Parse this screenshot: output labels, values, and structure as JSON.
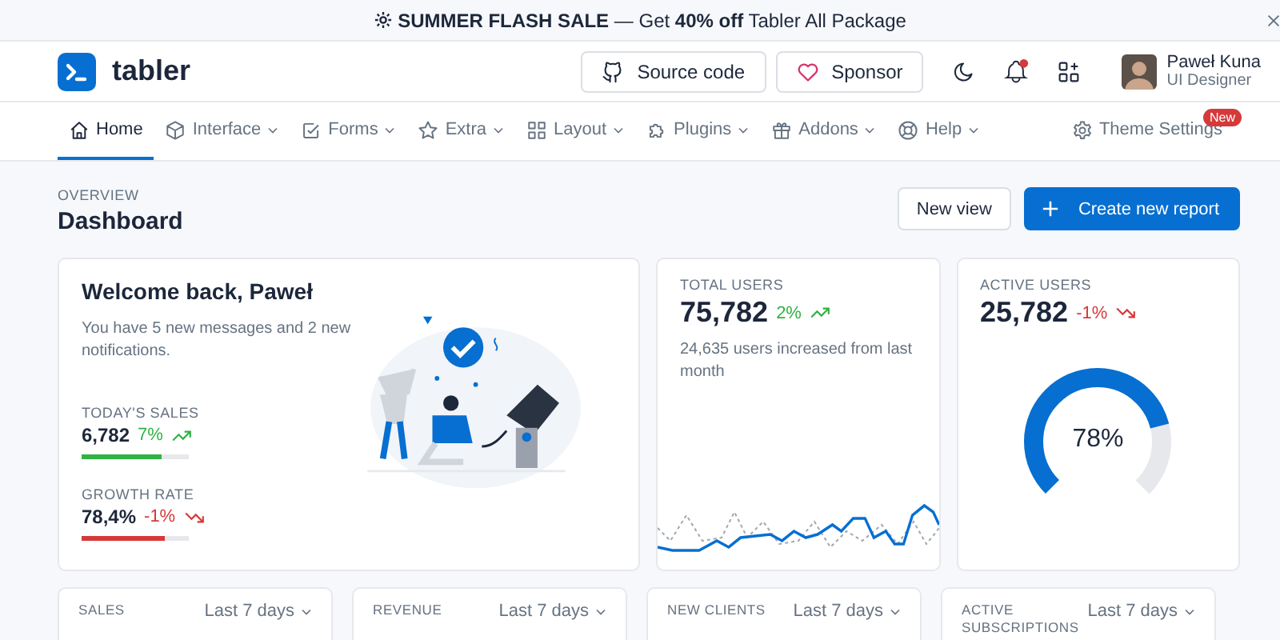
{
  "banner": {
    "text": "**SUMMER FLASH SALE** — Get **40% off** Tabler All Package"
  },
  "header": {
    "brand": "tabler",
    "buttons": [
      {
        "label": "Source code",
        "kind": "github"
      },
      {
        "label": "Sponsor",
        "kind": "heart"
      }
    ],
    "user": {
      "name": "Paweł Kuna",
      "role": "UI Designer"
    }
  },
  "nav": {
    "items": [
      {
        "label": "Home",
        "selected": true,
        "dropdown": false
      },
      {
        "label": "Interface",
        "selected": false,
        "dropdown": true
      },
      {
        "label": "Forms",
        "selected": false,
        "dropdown": true
      },
      {
        "label": "Extra",
        "selected": false,
        "dropdown": true
      },
      {
        "label": "Layout",
        "selected": false,
        "dropdown": true
      },
      {
        "label": "Plugins",
        "selected": false,
        "dropdown": true
      },
      {
        "label": "Addons",
        "selected": false,
        "dropdown": true
      },
      {
        "label": "Help",
        "selected": false,
        "dropdown": true
      }
    ],
    "settings": {
      "label": "Theme Settings",
      "badge": "New"
    }
  },
  "page": {
    "pretitle": "OVERVIEW",
    "title": "Dashboard",
    "actions": [
      {
        "label": "New view",
        "kind": "secondary"
      },
      {
        "label": "Create new report",
        "kind": "primary"
      }
    ]
  },
  "welcome": {
    "title": "Welcome back, Paweł",
    "text": "You have 5 new messages and 2 new notifications.",
    "stats": [
      {
        "label": "TODAY'S SALES",
        "value": "6,782",
        "change": "7%",
        "kind": "up",
        "level": 0.75
      },
      {
        "label": "GROWTH RATE",
        "value": "78,4%",
        "change": "-1%",
        "kind": "down",
        "level": 0.78
      }
    ]
  },
  "total_users": {
    "label": "TOTAL USERS",
    "value": "75,782",
    "change": "2%",
    "kind": "up",
    "text": "24,635 users increased from last month"
  },
  "active_users": {
    "label": "ACTIVE USERS",
    "value": "25,782",
    "change": "-1%",
    "kind": "down",
    "level": 0.78,
    "reading": "78%"
  },
  "summary_cards": [
    {
      "label": "SALES",
      "period": "Last 7 days"
    },
    {
      "label": "REVENUE",
      "period": "Last 7 days"
    },
    {
      "label": "NEW CLIENTS",
      "period": "Last 7 days"
    },
    {
      "label": "ACTIVE SUBSCRIPTIONS",
      "period": "Last 7 days"
    }
  ]
}
